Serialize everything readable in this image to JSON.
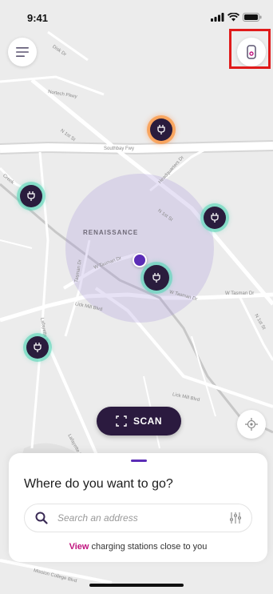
{
  "status_bar": {
    "time": "9:41"
  },
  "map": {
    "area_label": "RENAISSANCE",
    "streets": [
      "Disk Dr",
      "Nortech Pkwy",
      "N 1st St",
      "Southbay Fwy",
      "Headquarters Dr",
      "N 1st St",
      "W Tasman Dr",
      "Tasman Dr",
      "Lick Mill Blvd",
      "W Tasman Dr",
      "W Tasman Dr",
      "N 1st St",
      "Lick Mill Blvd",
      "Lafayette St",
      "Mission College Blvd",
      "Creek",
      "Lafayette St"
    ]
  },
  "top_buttons": {
    "menu_icon": "hamburger-menu-icon",
    "device_icon": "charger-device-icon",
    "highlight_color": "#e01a1a"
  },
  "stations": [
    {
      "status": "orange",
      "icon": "charging-plug-icon"
    },
    {
      "status": "green",
      "icon": "charging-plug-icon"
    },
    {
      "status": "green",
      "icon": "charging-plug-icon"
    },
    {
      "status": "green",
      "icon": "charging-plug-icon"
    },
    {
      "status": "green",
      "icon": "charging-plug-icon"
    }
  ],
  "scan": {
    "label": "SCAN",
    "icon": "scan-frame-icon"
  },
  "locate": {
    "icon": "crosshair-locate-icon"
  },
  "sheet": {
    "title": "Where do you want to go?",
    "search_placeholder": "Search an address",
    "search_icon": "search-icon",
    "filter_icon": "filter-sliders-icon",
    "view_link": "View",
    "view_rest": " charging stations close to you"
  },
  "colors": {
    "accent_purple": "#5b2db6",
    "dark_purple": "#2b1a3f",
    "link_magenta": "#c0137e",
    "station_green": "#54d6b6",
    "station_orange": "#ff8c28"
  }
}
